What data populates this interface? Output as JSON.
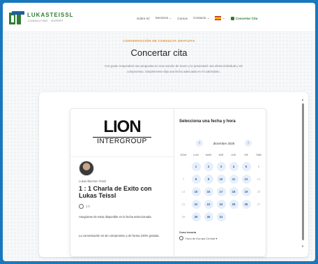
{
  "header": {
    "logo_name": "LUKASTEISSL",
    "logo_tag": "CONSULTING · EXPERT",
    "nav": [
      "Sobre mí",
      "Servicios ⌄",
      "Cursos",
      "Contacto ⌄",
      "⌄"
    ],
    "cta_label": "Concertar Cita"
  },
  "hero": {
    "eyebrow": "CONVERSACIÓN DE CONSULTA GRATUITA",
    "title": "Concertar cita",
    "lead": "Con gusto responderé sus preguntas en una reunión de Zoom y le presentaré una oferta individual y sin compromiso. Simplemente elija una fecha adecuada en mi calendario."
  },
  "widget": {
    "brand_word": "LION",
    "brand_sub": "INTERGROUP",
    "host": "Lukas Blochen Teissl",
    "event_title": "1 : 1 Charla de Exito con Lukas Teissl",
    "duration": "1 h",
    "desc1": "Asegúrese de estar disponible en la fecha seleccionada.",
    "desc2": "La conversación es sin compromiso y de forma 100% gratuita.",
    "calendar": {
      "heading": "Selecciona una fecha y hora",
      "month": "diciembre 2025",
      "prev": "‹",
      "next": "›",
      "weekdays": [
        "DOM",
        "LUN",
        "MAR",
        "MIÉ",
        "JUE",
        "VIE",
        "SÁB"
      ],
      "days": [
        {
          "d": "",
          "a": false
        },
        {
          "d": "1",
          "a": true
        },
        {
          "d": "2",
          "a": true
        },
        {
          "d": "3",
          "a": true
        },
        {
          "d": "4",
          "a": true
        },
        {
          "d": "5",
          "a": true
        },
        {
          "d": "6",
          "a": false
        },
        {
          "d": "7",
          "a": false
        },
        {
          "d": "8",
          "a": true
        },
        {
          "d": "9",
          "a": true
        },
        {
          "d": "10",
          "a": true
        },
        {
          "d": "11",
          "a": true
        },
        {
          "d": "12",
          "a": true
        },
        {
          "d": "13",
          "a": false
        },
        {
          "d": "14",
          "a": false
        },
        {
          "d": "15",
          "a": true
        },
        {
          "d": "16",
          "a": true
        },
        {
          "d": "17",
          "a": true
        },
        {
          "d": "18",
          "a": true
        },
        {
          "d": "19",
          "a": true
        },
        {
          "d": "20",
          "a": false
        },
        {
          "d": "21",
          "a": false
        },
        {
          "d": "22",
          "a": true
        },
        {
          "d": "23",
          "a": true
        },
        {
          "d": "24",
          "a": true
        },
        {
          "d": "25",
          "a": true
        },
        {
          "d": "26",
          "a": true
        },
        {
          "d": "27",
          "a": false
        },
        {
          "d": "28",
          "a": false
        },
        {
          "d": "29",
          "a": true
        },
        {
          "d": "30",
          "a": true
        },
        {
          "d": "31",
          "a": true
        },
        {
          "d": "",
          "a": false
        },
        {
          "d": "",
          "a": false
        },
        {
          "d": "",
          "a": false
        }
      ],
      "tz_label": "Zona horaria",
      "tz_value": "Hora de Europa Central ▾"
    }
  },
  "colors": {
    "frame_blue": "#1977bd",
    "brand_green": "#2e7d32",
    "accent_orange": "#e09530",
    "day_available_bg": "#e6effa",
    "day_available_fg": "#2f5d9e"
  }
}
